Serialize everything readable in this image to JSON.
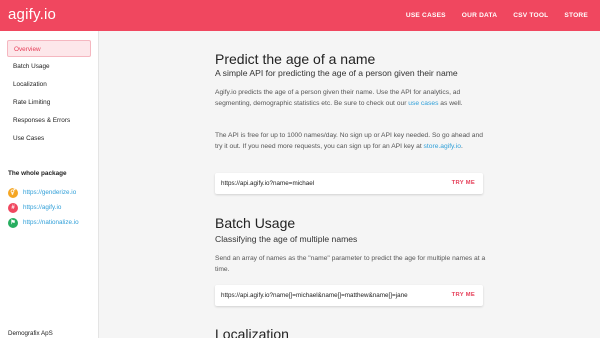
{
  "brand": "agify.io",
  "topnav": [
    "USE CASES",
    "OUR DATA",
    "CSV TOOL",
    "STORE"
  ],
  "sidebar": {
    "items": [
      {
        "label": "Overview",
        "active": true
      },
      {
        "label": "Batch Usage"
      },
      {
        "label": "Localization"
      },
      {
        "label": "Rate Limiting"
      },
      {
        "label": "Responses & Errors"
      },
      {
        "label": "Use Cases"
      }
    ],
    "package_title": "The whole package",
    "packages": [
      {
        "label": "https://genderize.io",
        "color": "#f5a623",
        "icon": "genderize-icon"
      },
      {
        "label": "https://agify.io",
        "color": "#f0475f",
        "icon": "agify-icon"
      },
      {
        "label": "https://nationalize.io",
        "color": "#27ae60",
        "icon": "flag-icon"
      }
    ],
    "company": "Demografix ApS"
  },
  "sections": {
    "predict": {
      "title": "Predict the age of a name",
      "subtitle": "A simple API for predicting the age of a person given their name",
      "p1_before": "Agify.io predicts the age of a person given their name. Use the API for analytics, ad segmenting, demographic statistics etc. Be sure to check out our ",
      "p1_link": "use cases",
      "p1_after": " as well.",
      "p2_before": "The API is free for up to 1000 names/day. No sign up or API key needed. So go ahead and try it out. If you need more requests, you can sign up for an API key at ",
      "p2_link": "store.agify.io",
      "p2_after": ".",
      "code": "https://api.agify.io?name=michael",
      "try": "TRY ME"
    },
    "batch": {
      "title": "Batch Usage",
      "subtitle": "Classifying the age of multiple names",
      "p1": "Send an array of names as the \"name\" parameter to predict the age for multiple names at a time.",
      "code": "https://api.agify.io?name[]=michael&name[]=matthew&name[]=jane",
      "try": "TRY ME"
    },
    "localization": {
      "title": "Localization"
    }
  }
}
